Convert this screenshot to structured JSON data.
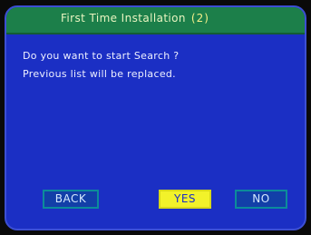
{
  "dialog": {
    "title": "First Time Installation",
    "step": "(2)",
    "message_line1": "Do you want to start Search ?",
    "message_line2": "Previous list will be replaced."
  },
  "buttons": {
    "back": "BACK",
    "yes": "YES",
    "no": "NO"
  },
  "colors": {
    "dialog_background": "#1b2fc4",
    "title_bar": "#1c7f4a",
    "selected_button": "#f2f22a"
  }
}
